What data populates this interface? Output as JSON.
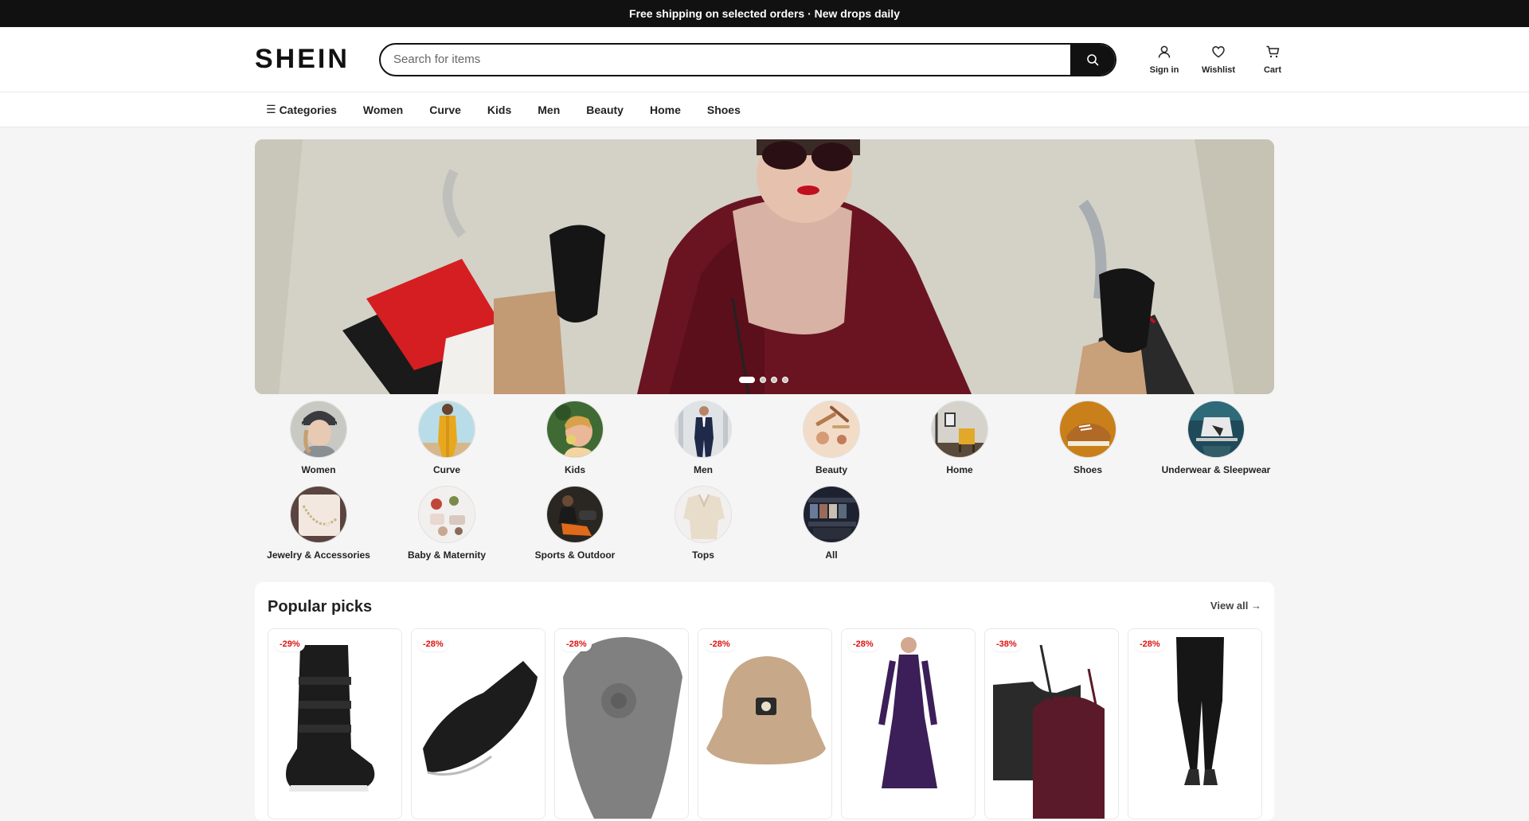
{
  "topbar": {
    "text": "Free shipping on selected orders · New drops daily"
  },
  "header": {
    "logo": "SHEIN",
    "search_placeholder": "Search for items",
    "actions": [
      {
        "label": "Sign in",
        "icon": "user-icon"
      },
      {
        "label": "Wishlist",
        "icon": "heart-icon"
      },
      {
        "label": "Cart",
        "icon": "cart-icon"
      }
    ]
  },
  "nav": {
    "items": [
      "Categories",
      "Women",
      "Curve",
      "Kids",
      "Men",
      "Beauty",
      "Home",
      "Shoes"
    ]
  },
  "hero": {
    "slides": 4,
    "active_slide": 1
  },
  "categories": [
    "Women",
    "Curve",
    "Kids",
    "Men",
    "Beauty",
    "Home",
    "Shoes",
    "Underwear & Sleepwear",
    "Jewelry & Accessories",
    "Baby & Maternity",
    "Sports & Outdoor",
    "Tops",
    "All"
  ],
  "popular": {
    "title": "Popular picks",
    "view_all": "View all →",
    "products": [
      {
        "discount": "-29%",
        "image": "snow-boot"
      },
      {
        "discount": "-28%",
        "image": "water-shoe"
      },
      {
        "discount": "-28%",
        "image": "knit-beret"
      },
      {
        "discount": "-28%",
        "image": "sherpa-bucket-hat"
      },
      {
        "discount": "-28%",
        "image": "purple-dress"
      },
      {
        "discount": "-38%",
        "image": "tank-tops"
      },
      {
        "discount": "-28%",
        "image": "black-leggings"
      }
    ]
  },
  "colors": {
    "accent": "#111111",
    "discount": "#dd1111"
  }
}
